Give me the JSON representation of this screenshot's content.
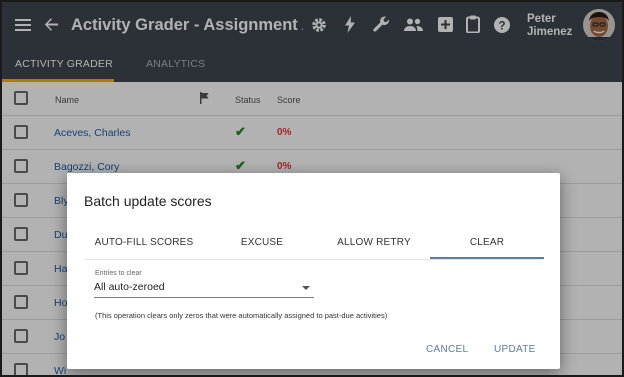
{
  "header": {
    "title": "Activity Grader - Assignment Acti...",
    "user_first": "Peter",
    "user_last": "Jimenez"
  },
  "tabs": [
    {
      "label": "ACTIVITY GRADER",
      "active": true
    },
    {
      "label": "ANALYTICS",
      "active": false
    }
  ],
  "table": {
    "columns": {
      "name": "Name",
      "status": "Status",
      "score": "Score"
    },
    "rows": [
      {
        "name": "Aceves, Charles",
        "score": "0%"
      },
      {
        "name": "Bagozzi, Cory",
        "score": "0%"
      },
      {
        "name": "Bly",
        "score": ""
      },
      {
        "name": "Du",
        "score": ""
      },
      {
        "name": "Ha",
        "score": ""
      },
      {
        "name": "Ho",
        "score": ""
      },
      {
        "name": "Jo",
        "score": ""
      },
      {
        "name": "Wi",
        "score": ""
      }
    ]
  },
  "dialog": {
    "title": "Batch update scores",
    "tabs": [
      "AUTO-FILL SCORES",
      "EXCUSE",
      "ALLOW RETRY",
      "CLEAR"
    ],
    "active_tab": "CLEAR",
    "field_label": "Entries to clear",
    "field_value": "All auto-zeroed",
    "note": "(This operation clears only zeros that were automatically assigned to past-due activities)",
    "cancel_label": "CANCEL",
    "update_label": "UPDATE"
  },
  "colors": {
    "appbar": "#3f4750",
    "accent_tab": "#f5b400",
    "link": "#1a5ea8",
    "dialog_accent": "#5d8093",
    "score_red": "#e33",
    "status_green": "#2a8a2a"
  },
  "icons": [
    "menu-icon",
    "back-arrow-icon",
    "gear-icon",
    "lightning-icon",
    "wrench-icon",
    "people-icon",
    "add-box-icon",
    "clipboard-icon",
    "help-icon",
    "flag-icon",
    "check-icon",
    "dropdown-caret-icon"
  ]
}
